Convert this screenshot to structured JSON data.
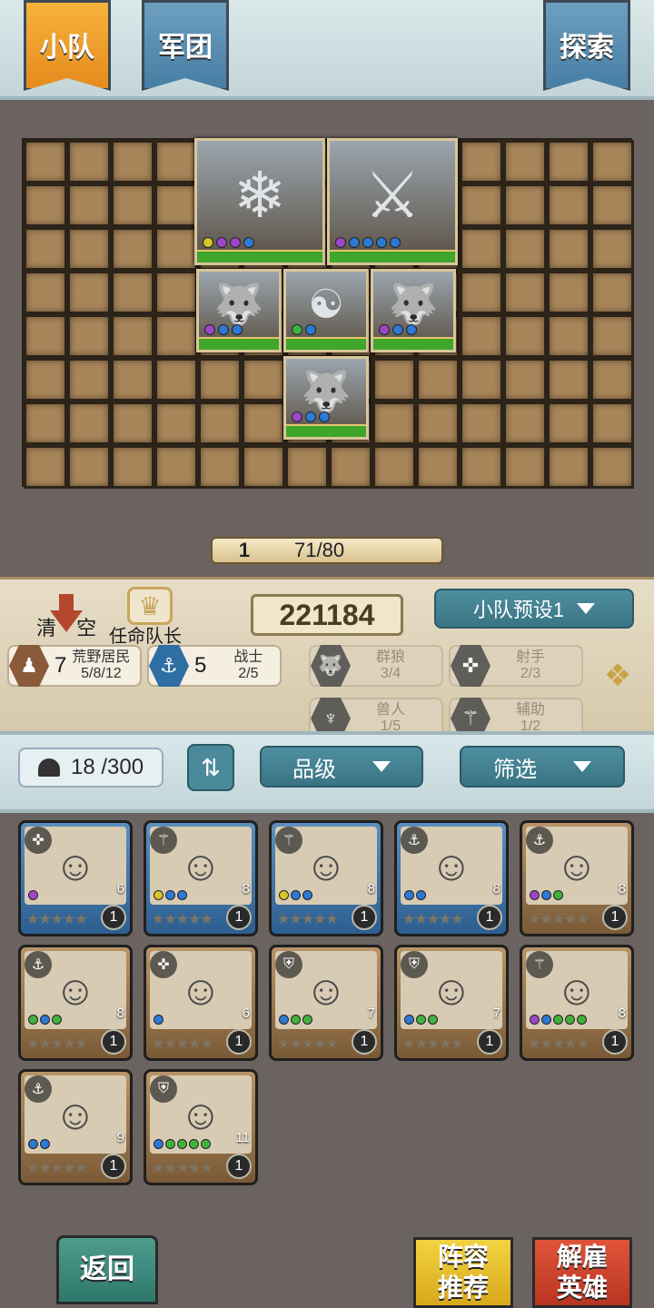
{
  "tabs": {
    "squad": "小队",
    "legion": "军团",
    "explore": "探索"
  },
  "board": {
    "level": "1",
    "capacity": "71/80",
    "units": [
      {
        "name": "yeti",
        "icon": "❄",
        "dots": [
          "yellow",
          "purple",
          "purple",
          "blue"
        ]
      },
      {
        "name": "viking",
        "icon": "⚔",
        "dots": [
          "purple",
          "blue",
          "blue",
          "blue",
          "blue"
        ]
      },
      {
        "name": "wolf",
        "icon": "🐺",
        "dots": [
          "purple",
          "blue",
          "blue"
        ]
      },
      {
        "name": "shaman",
        "icon": "☯",
        "dots": [
          "green",
          "blue"
        ]
      },
      {
        "name": "wolf",
        "icon": "🐺",
        "dots": [
          "purple",
          "blue",
          "blue"
        ]
      },
      {
        "name": "wolf",
        "icon": "🐺",
        "dots": [
          "purple",
          "blue",
          "blue"
        ]
      }
    ]
  },
  "panel": {
    "clear_label": "清 空",
    "captain_label": "任命队长",
    "power": "221184",
    "preset": "小队预设1"
  },
  "factions": [
    {
      "icon": "wildling-icon",
      "count": "7",
      "name": "荒野居民",
      "value": "5/8/12",
      "active": true
    },
    {
      "icon": "warrior-icon",
      "count": "5",
      "name": "战士",
      "value": "2/5",
      "active": true
    },
    {
      "icon": "wolf-pack-icon",
      "count": "",
      "name": "群狼",
      "value": "3/4",
      "active": false
    },
    {
      "icon": "archer-icon",
      "count": "",
      "name": "射手",
      "value": "2/3",
      "active": false
    },
    {
      "icon": "orc-icon",
      "count": "",
      "name": "兽人",
      "value": "1/5",
      "active": false
    },
    {
      "icon": "support-icon",
      "count": "",
      "name": "辅助",
      "value": "1/2",
      "active": false
    }
  ],
  "filter": {
    "hero_count": "18 /300",
    "grade_label": "品级",
    "filter_label": "筛选"
  },
  "heroes": [
    {
      "frame": "blue",
      "cls": "archer",
      "cost": "6",
      "level": "1",
      "dots": [
        "purple"
      ]
    },
    {
      "frame": "blue",
      "cls": "support",
      "cost": "8",
      "level": "1",
      "dots": [
        "yellow",
        "blue",
        "blue"
      ]
    },
    {
      "frame": "blue",
      "cls": "support",
      "cost": "8",
      "level": "1",
      "dots": [
        "yellow",
        "blue",
        "blue"
      ]
    },
    {
      "frame": "blue",
      "cls": "warrior",
      "cost": "8",
      "level": "1",
      "dots": [
        "blue",
        "blue"
      ]
    },
    {
      "frame": "brown",
      "cls": "warrior",
      "cost": "8",
      "level": "1",
      "dots": [
        "purple",
        "blue",
        "green"
      ]
    },
    {
      "frame": "brown",
      "cls": "warrior",
      "cost": "8",
      "level": "1",
      "dots": [
        "green",
        "blue",
        "green"
      ]
    },
    {
      "frame": "brown",
      "cls": "archer",
      "cost": "6",
      "level": "1",
      "dots": [
        "blue"
      ]
    },
    {
      "frame": "brown",
      "cls": "tank",
      "cost": "7",
      "level": "1",
      "dots": [
        "blue",
        "green",
        "green"
      ]
    },
    {
      "frame": "brown",
      "cls": "tank",
      "cost": "7",
      "level": "1",
      "dots": [
        "blue",
        "green",
        "green"
      ]
    },
    {
      "frame": "brown",
      "cls": "support",
      "cost": "8",
      "level": "1",
      "dots": [
        "purple",
        "blue",
        "green",
        "green",
        "green"
      ]
    },
    {
      "frame": "brown",
      "cls": "warrior",
      "cost": "9",
      "level": "1",
      "dots": [
        "blue",
        "blue"
      ]
    },
    {
      "frame": "brown",
      "cls": "tank",
      "cost": "11",
      "level": "1",
      "dots": [
        "blue",
        "green",
        "green",
        "green",
        "green"
      ]
    }
  ],
  "buttons": {
    "back": "返回",
    "recommend": "阵容推荐",
    "fire": "解雇英雄"
  },
  "colors": {
    "accent_orange": "#f0a02c",
    "accent_teal": "#3a7484",
    "hp_green": "#3fa52b"
  }
}
